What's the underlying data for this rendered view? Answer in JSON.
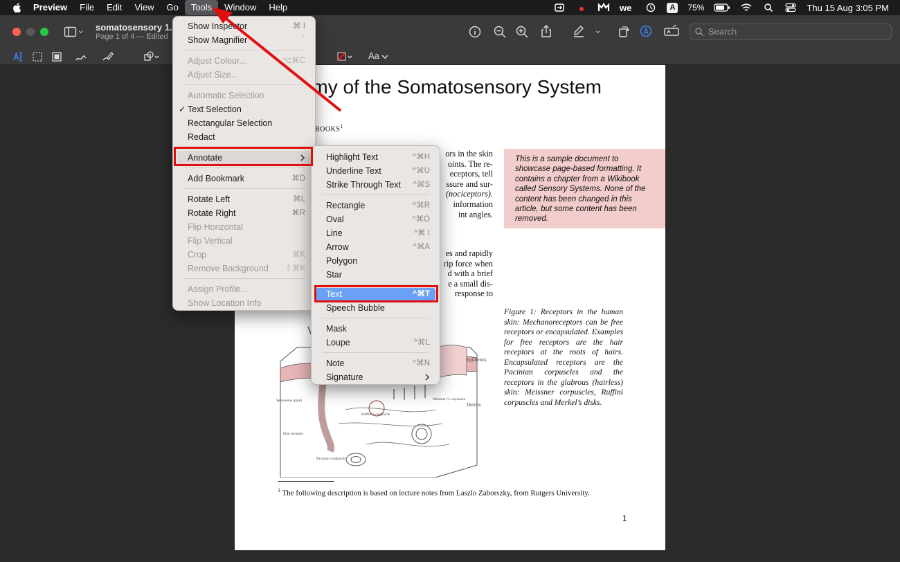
{
  "menubar": {
    "app": "Preview",
    "items": [
      "File",
      "Edit",
      "View",
      "Go",
      "Tools",
      "Window",
      "Help"
    ],
    "battery": "75%",
    "datetime": "Thu 15 Aug  3:05 PM",
    "input_badge": "A"
  },
  "window": {
    "doc_title": "somatosensory 1.p",
    "doc_subtitle": "Page 1 of 4 — Edited",
    "search_placeholder": "Search",
    "font_button": "Aa"
  },
  "page": {
    "title": "omy of the Somatosensory System",
    "author": "BOOKS",
    "author_sup": "1",
    "para1": [
      "ors in the skin",
      "oints.  The re-",
      "eceptors, tell",
      "ssure and sur-",
      "(nociceptors).",
      "information",
      "int angles."
    ],
    "para2": [
      "es and rapidly",
      "rip force when",
      "d with a brief",
      "e a small dis-",
      "response to"
    ],
    "note": "This is a sample document to showcase page-based formatting. It contains a chapter from a Wikibook called Sensory Systems. None of the content has been changed in this article, but some content has been removed.",
    "caption": "Figure 1:  Receptors in the human skin: Mechanoreceptors can be free receptors or encapsulated. Examples for free receptors are the hair receptors at the roots of hairs. Encapsulated receptors are the Pacinian corpuscles and the receptors in the glabrous (hairless) skin: Meissner corpuscles, Ruffini corpuscles and Merkel’s disks.",
    "figure_labels": {
      "epidermis": "Epidermis",
      "dermis": "Dermis",
      "sebaceous": "Sebaceous gland",
      "ruffini": "Ruffini's corpuscle",
      "meissner": "Meissne r's corpuscle",
      "hair": "Hair receptor",
      "pacinian": "Pacinian corpuscle"
    },
    "footnote_sup": "1",
    "footnote": "The following description is based on lecture notes from Laszlo Zaborszky, from Rutgers University.",
    "page_number": "1"
  },
  "tools_menu": {
    "items": [
      {
        "label": "Show Inspector",
        "shortcut": "⌘ I",
        "disabled": false
      },
      {
        "label": "Show Magnifier",
        "shortcut": "`",
        "disabled": false
      },
      {
        "label": "Adjust Colour...",
        "shortcut": "⌥⌘C",
        "disabled": true
      },
      {
        "label": "Adjust Size...",
        "shortcut": "",
        "disabled": true
      },
      {
        "label": "Automatic Selection",
        "shortcut": "",
        "disabled": true
      },
      {
        "label": "Text Selection",
        "shortcut": "",
        "disabled": false,
        "checked": true
      },
      {
        "label": "Rectangular Selection",
        "shortcut": "",
        "disabled": false
      },
      {
        "label": "Redact",
        "shortcut": "",
        "disabled": false
      },
      {
        "label": "Annotate",
        "shortcut": "",
        "disabled": false,
        "submenu": true
      },
      {
        "label": "Add Bookmark",
        "shortcut": "⌘D",
        "disabled": false
      },
      {
        "label": "Rotate Left",
        "shortcut": "⌘L",
        "disabled": false
      },
      {
        "label": "Rotate Right",
        "shortcut": "⌘R",
        "disabled": false
      },
      {
        "label": "Flip Horizontal",
        "shortcut": "",
        "disabled": true
      },
      {
        "label": "Flip Vertical",
        "shortcut": "",
        "disabled": true
      },
      {
        "label": "Crop",
        "shortcut": "⌘K",
        "disabled": true
      },
      {
        "label": "Remove Background",
        "shortcut": "⇧⌘K",
        "disabled": true
      },
      {
        "label": "Assign Profile...",
        "shortcut": "",
        "disabled": true
      },
      {
        "label": "Show Location Info",
        "shortcut": "",
        "disabled": true
      }
    ],
    "checkmark": "✓"
  },
  "annotate_menu": {
    "items": [
      {
        "label": "Highlight Text",
        "shortcut": "^⌘H"
      },
      {
        "label": "Underline Text",
        "shortcut": "^⌘U"
      },
      {
        "label": "Strike Through Text",
        "shortcut": "^⌘S"
      },
      {
        "label": "Rectangle",
        "shortcut": "^⌘R"
      },
      {
        "label": "Oval",
        "shortcut": "^⌘O"
      },
      {
        "label": "Line",
        "shortcut": "^⌘ I"
      },
      {
        "label": "Arrow",
        "shortcut": "^⌘A"
      },
      {
        "label": "Polygon",
        "shortcut": ""
      },
      {
        "label": "Star",
        "shortcut": ""
      },
      {
        "label": "Text",
        "shortcut": "^⌘T"
      },
      {
        "label": "Speech Bubble",
        "shortcut": ""
      },
      {
        "label": "Mask",
        "shortcut": ""
      },
      {
        "label": "Loupe",
        "shortcut": "^⌘L"
      },
      {
        "label": "Note",
        "shortcut": "^⌘N"
      },
      {
        "label": "Signature",
        "shortcut": ""
      }
    ]
  },
  "colors": {
    "highlight": "#6aa0f5",
    "annotation_red": "#e01010",
    "note_bg": "#f3cccc"
  }
}
